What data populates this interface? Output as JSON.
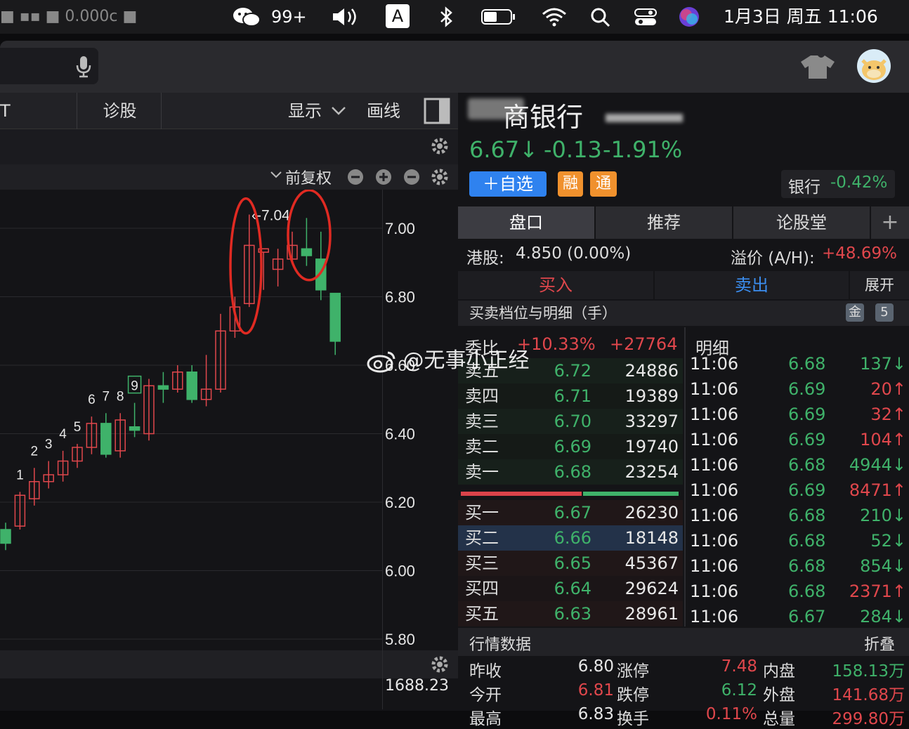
{
  "menubar": {
    "left_blur": "■ ▪▪ ■ 0.000c ■",
    "wechat_badge": "99+",
    "input_method": "A",
    "datetime": "1月3日 周五 11:06"
  },
  "toolbar": {
    "tab_partial": "T",
    "diagnose": "诊股",
    "display": "显示",
    "draw": "画线"
  },
  "chart": {
    "adjust": "前复权",
    "ylabels": [
      "7.00",
      "6.80",
      "6.60",
      "6.40",
      "6.20",
      "6.00",
      "5.80"
    ],
    "sub_value": "1688.23",
    "high_label": "-7.04",
    "tags": [
      "1",
      "2",
      "3",
      "4",
      "5",
      "6",
      "7",
      "8",
      "9"
    ],
    "watermark": "@无事小正经"
  },
  "chart_data": {
    "type": "candlestick",
    "ylim": [
      5.8,
      7.1
    ],
    "candles": [
      [
        6.12,
        6.08,
        6.14,
        6.06
      ],
      [
        6.13,
        6.22,
        6.23,
        6.12
      ],
      [
        6.21,
        6.26,
        6.3,
        6.19
      ],
      [
        6.26,
        6.28,
        6.32,
        6.24
      ],
      [
        6.28,
        6.32,
        6.35,
        6.26
      ],
      [
        6.32,
        6.36,
        6.37,
        6.3
      ],
      [
        6.36,
        6.43,
        6.45,
        6.34
      ],
      [
        6.43,
        6.34,
        6.46,
        6.33
      ],
      [
        6.35,
        6.44,
        6.46,
        6.33
      ],
      [
        6.42,
        6.41,
        6.49,
        6.39
      ],
      [
        6.4,
        6.54,
        6.56,
        6.38
      ],
      [
        6.54,
        6.53,
        6.58,
        6.49
      ],
      [
        6.53,
        6.58,
        6.6,
        6.52
      ],
      [
        6.58,
        6.5,
        6.6,
        6.49
      ],
      [
        6.5,
        6.53,
        6.63,
        6.48
      ],
      [
        6.53,
        6.7,
        6.75,
        6.52
      ],
      [
        6.7,
        6.77,
        6.8,
        6.68
      ],
      [
        6.78,
        6.95,
        7.04,
        6.77
      ],
      [
        6.93,
        6.94,
        6.93,
        6.82
      ],
      [
        6.88,
        6.91,
        6.94,
        6.83
      ],
      [
        6.91,
        6.95,
        6.99,
        6.9
      ],
      [
        6.94,
        6.92,
        7.03,
        6.89
      ],
      [
        6.91,
        6.82,
        6.99,
        6.79
      ],
      [
        6.81,
        6.67,
        6.81,
        6.63
      ]
    ]
  },
  "stock": {
    "name": "商银行",
    "price": "6.67↓",
    "change": "-0.13",
    "pct": "-1.91%",
    "watch_btn": "＋自选",
    "tag_rong": "融",
    "tag_tong": "通",
    "sector": "银行",
    "sector_pct": "-0.42%"
  },
  "tabs": [
    "盘口",
    "推荐",
    "论股堂"
  ],
  "hk": {
    "label": "港股:",
    "value": "4.850 (0.00%)",
    "premium_label": "溢价 (A/H):",
    "premium": "+48.69%"
  },
  "trade": {
    "buy": "买入",
    "sell": "卖出",
    "expand": "展开"
  },
  "book_title": "买卖档位与明细（手）",
  "badge_gold": "金",
  "badge_five": "5",
  "ratio": {
    "label": "委比",
    "pct": "+10.33%",
    "diff": "+27764"
  },
  "detail_title": "明细",
  "asks": [
    {
      "l": "卖五",
      "p": "6.72",
      "v": "24886"
    },
    {
      "l": "卖四",
      "p": "6.71",
      "v": "19389"
    },
    {
      "l": "卖三",
      "p": "6.70",
      "v": "33297"
    },
    {
      "l": "卖二",
      "p": "6.69",
      "v": "19740"
    },
    {
      "l": "卖一",
      "p": "6.68",
      "v": "23254"
    }
  ],
  "bids": [
    {
      "l": "买一",
      "p": "6.67",
      "v": "26230"
    },
    {
      "l": "买二",
      "p": "6.66",
      "v": "18148"
    },
    {
      "l": "买三",
      "p": "6.65",
      "v": "45367"
    },
    {
      "l": "买四",
      "p": "6.64",
      "v": "29624"
    },
    {
      "l": "买五",
      "p": "6.63",
      "v": "28961"
    }
  ],
  "ticks": [
    {
      "t": "11:06",
      "p": "6.68",
      "v": "137↓",
      "c": "g"
    },
    {
      "t": "11:06",
      "p": "6.69",
      "v": "20↑",
      "c": "r"
    },
    {
      "t": "11:06",
      "p": "6.69",
      "v": "32↑",
      "c": "r"
    },
    {
      "t": "11:06",
      "p": "6.69",
      "v": "104↑",
      "c": "r"
    },
    {
      "t": "11:06",
      "p": "6.68",
      "v": "4944↓",
      "c": "g"
    },
    {
      "t": "11:06",
      "p": "6.69",
      "v": "8471↑",
      "c": "r"
    },
    {
      "t": "11:06",
      "p": "6.68",
      "v": "210↓",
      "c": "g"
    },
    {
      "t": "11:06",
      "p": "6.68",
      "v": "52↓",
      "c": "g"
    },
    {
      "t": "11:06",
      "p": "6.68",
      "v": "854↓",
      "c": "g"
    },
    {
      "t": "11:06",
      "p": "6.68",
      "v": "2371↑",
      "c": "r"
    },
    {
      "t": "11:06",
      "p": "6.67",
      "v": "284↓",
      "c": "g"
    }
  ],
  "market": {
    "title": "行情数据",
    "fold": "折叠",
    "r1": {
      "a": "昨收",
      "av": "6.80",
      "b": "涨停",
      "bv": "7.48",
      "c": "内盘",
      "cv": "158.13万"
    },
    "r2": {
      "a": "今开",
      "av": "6.81",
      "b": "跌停",
      "bv": "6.12",
      "c": "外盘",
      "cv": "141.68万"
    },
    "r3": {
      "a": "最高",
      "av": "6.83",
      "b": "换手",
      "bv": "0.11%",
      "c": "总量",
      "cv": "299.80万"
    }
  }
}
